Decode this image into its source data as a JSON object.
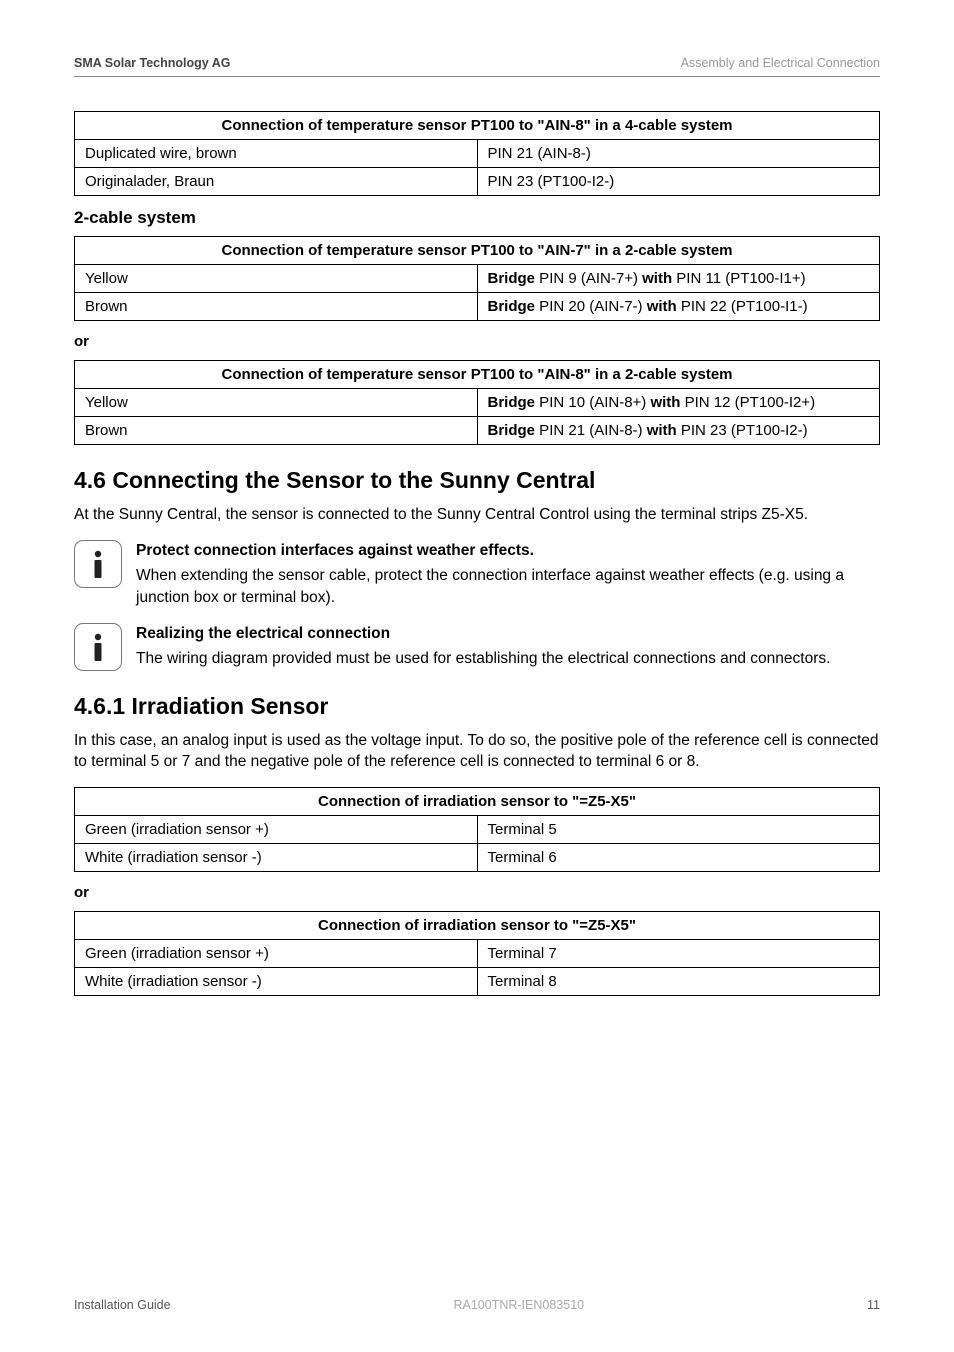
{
  "header": {
    "left": "SMA Solar Technology AG",
    "right": "Assembly and Electrical Connection"
  },
  "table1": {
    "caption": "Connection of temperature sensor PT100 to \"AIN-8\" in a 4-cable system",
    "rows": [
      {
        "c1": "Duplicated wire, brown",
        "c2": "PIN 21 (AIN-8-)"
      },
      {
        "c1": "Originalader, Braun",
        "c2": "PIN 23 (PT100-I2-)"
      }
    ]
  },
  "subheading1": "2-cable system",
  "table2": {
    "caption": "Connection of temperature sensor PT100 to \"AIN-7\" in a 2-cable system",
    "rows": [
      {
        "c1": "Yellow",
        "c2pre": "Bridge",
        "c2mid": " PIN 9 (AIN-7+) ",
        "c2bold": "with",
        "c2post": " PIN 11 (PT100-I1+)"
      },
      {
        "c1": "Brown",
        "c2pre": "Bridge",
        "c2mid": " PIN 20 (AIN-7-) ",
        "c2bold": "with",
        "c2post": " PIN 22 (PT100-I1-)"
      }
    ]
  },
  "or": "or",
  "table3": {
    "caption": "Connection of temperature sensor PT100 to \"AIN-8\" in a 2-cable system",
    "rows": [
      {
        "c1": "Yellow",
        "c2pre": "Bridge",
        "c2mid": " PIN 10 (AIN-8+) ",
        "c2bold": "with",
        "c2post": " PIN 12 (PT100-I2+)"
      },
      {
        "c1": "Brown",
        "c2pre": "Bridge",
        "c2mid": " PIN 21 (AIN-8-) ",
        "c2bold": "with",
        "c2post": " PIN 23 (PT100-I2-)"
      }
    ]
  },
  "section46": {
    "heading": "4.6  Connecting the Sensor to the Sunny Central",
    "para": "At the Sunny Central, the sensor is connected to the Sunny Central Control using the terminal strips Z5-X5."
  },
  "info1": {
    "title": "Protect connection interfaces against weather effects.",
    "body": "When extending the sensor cable, protect the connection interface against weather effects (e.g. using a junction box or terminal box)."
  },
  "info2": {
    "title": "Realizing the electrical connection",
    "body": "The wiring diagram provided must be used for establishing the electrical connections and connectors."
  },
  "section461": {
    "heading": "4.6.1  Irradiation Sensor",
    "para": "In this case, an analog input is used as the voltage input. To do so, the positive pole of the reference cell is connected to terminal 5 or 7 and the negative pole of the reference cell is connected to terminal 6 or 8."
  },
  "table4": {
    "caption": "Connection of irradiation sensor to \"=Z5-X5\"",
    "rows": [
      {
        "c1": "Green (irradiation sensor +)",
        "c2": "Terminal 5"
      },
      {
        "c1": "White (irradiation sensor -)",
        "c2": "Terminal 6"
      }
    ]
  },
  "table5": {
    "caption": "Connection of irradiation sensor to \"=Z5-X5\"",
    "rows": [
      {
        "c1": "Green (irradiation sensor +)",
        "c2": "Terminal 7"
      },
      {
        "c1": "White (irradiation sensor -)",
        "c2": "Terminal 8"
      }
    ]
  },
  "footer": {
    "left": "Installation Guide",
    "center": "RA100TNR-IEN083510",
    "right": "11"
  }
}
